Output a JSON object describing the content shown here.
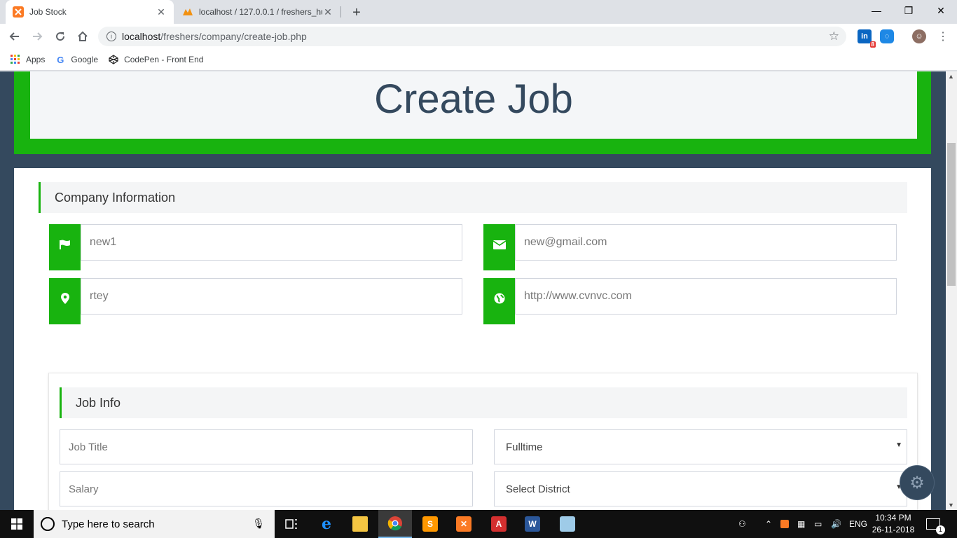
{
  "browser": {
    "tabs": [
      {
        "title": "Job Stock",
        "active": true
      },
      {
        "title": "localhost / 127.0.0.1 / freshers_hu",
        "active": false
      }
    ],
    "url_host": "localhost",
    "url_path": "/freshers/company/create-job.php",
    "bookmarks": [
      "Apps",
      "Google",
      "CodePen - Front End"
    ],
    "extension_badge": "8"
  },
  "page": {
    "hero_title": "Create Job",
    "company_section": {
      "heading": "Company Information",
      "company_name": "new1",
      "email": "new@gmail.com",
      "address": "rtey",
      "website": "http://www.cvnvc.com"
    },
    "job_section": {
      "heading": "Job Info",
      "job_title_placeholder": "Job Title",
      "job_type_selected": "Fulltime",
      "salary_placeholder": "Salary",
      "district_selected": "Select District"
    }
  },
  "taskbar": {
    "search_placeholder": "Type here to search",
    "language": "ENG",
    "time": "10:34 PM",
    "date": "26-11-2018",
    "notification_count": "1"
  },
  "colors": {
    "brand_green": "#18b30f",
    "page_dark": "#34495e",
    "section_bg": "#f4f5f6"
  }
}
